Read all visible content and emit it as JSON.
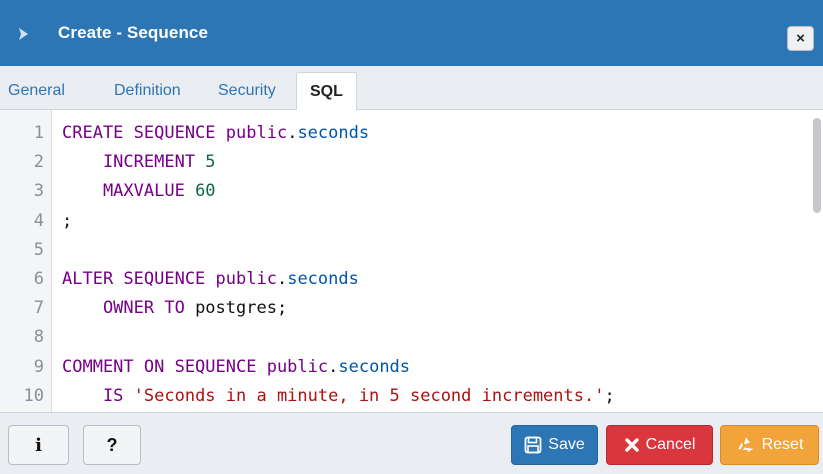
{
  "dialog": {
    "title": "Create - Sequence",
    "close_label": "×"
  },
  "tabs": [
    {
      "label": "General"
    },
    {
      "label": "Definition"
    },
    {
      "label": "Security"
    },
    {
      "label": "SQL",
      "active": true
    }
  ],
  "editor": {
    "lines": [
      {
        "n": "1",
        "tokens": [
          {
            "t": "CREATE SEQUENCE ",
            "c": "kw"
          },
          {
            "t": "public",
            "c": "kw"
          },
          {
            "t": ".",
            "c": "plain"
          },
          {
            "t": "seconds",
            "c": "def"
          }
        ]
      },
      {
        "n": "2",
        "tokens": [
          {
            "t": "    INCREMENT ",
            "c": "kw"
          },
          {
            "t": "5",
            "c": "num"
          }
        ]
      },
      {
        "n": "3",
        "tokens": [
          {
            "t": "    MAXVALUE ",
            "c": "kw"
          },
          {
            "t": "60",
            "c": "num"
          }
        ]
      },
      {
        "n": "4",
        "tokens": [
          {
            "t": ";",
            "c": "plain"
          }
        ]
      },
      {
        "n": "5",
        "tokens": []
      },
      {
        "n": "6",
        "tokens": [
          {
            "t": "ALTER SEQUENCE ",
            "c": "kw"
          },
          {
            "t": "public",
            "c": "kw"
          },
          {
            "t": ".",
            "c": "plain"
          },
          {
            "t": "seconds",
            "c": "def"
          }
        ]
      },
      {
        "n": "7",
        "tokens": [
          {
            "t": "    OWNER TO ",
            "c": "kw"
          },
          {
            "t": "postgres;",
            "c": "plain"
          }
        ]
      },
      {
        "n": "8",
        "tokens": []
      },
      {
        "n": "9",
        "tokens": [
          {
            "t": "COMMENT ON SEQUENCE ",
            "c": "kw"
          },
          {
            "t": "public",
            "c": "kw"
          },
          {
            "t": ".",
            "c": "plain"
          },
          {
            "t": "seconds",
            "c": "def"
          }
        ]
      },
      {
        "n": "10",
        "tokens": [
          {
            "t": "    IS ",
            "c": "kw"
          },
          {
            "t": "'Seconds in a minute, in 5 second increments.'",
            "c": "str"
          },
          {
            "t": ";",
            "c": "plain"
          }
        ]
      }
    ]
  },
  "footer": {
    "info_label": "i",
    "help_label": "?",
    "save_label": "Save",
    "cancel_label": "Cancel",
    "reset_label": "Reset"
  },
  "colors": {
    "header": "#2c76b6",
    "save": "#2c76b6",
    "cancel": "#d9363e",
    "reset": "#f2a33a"
  },
  "icons": {
    "app": "chevron-right-icon",
    "close": "close-icon",
    "save": "floppy-disk-icon",
    "cancel": "x-icon",
    "reset": "recycle-icon"
  }
}
